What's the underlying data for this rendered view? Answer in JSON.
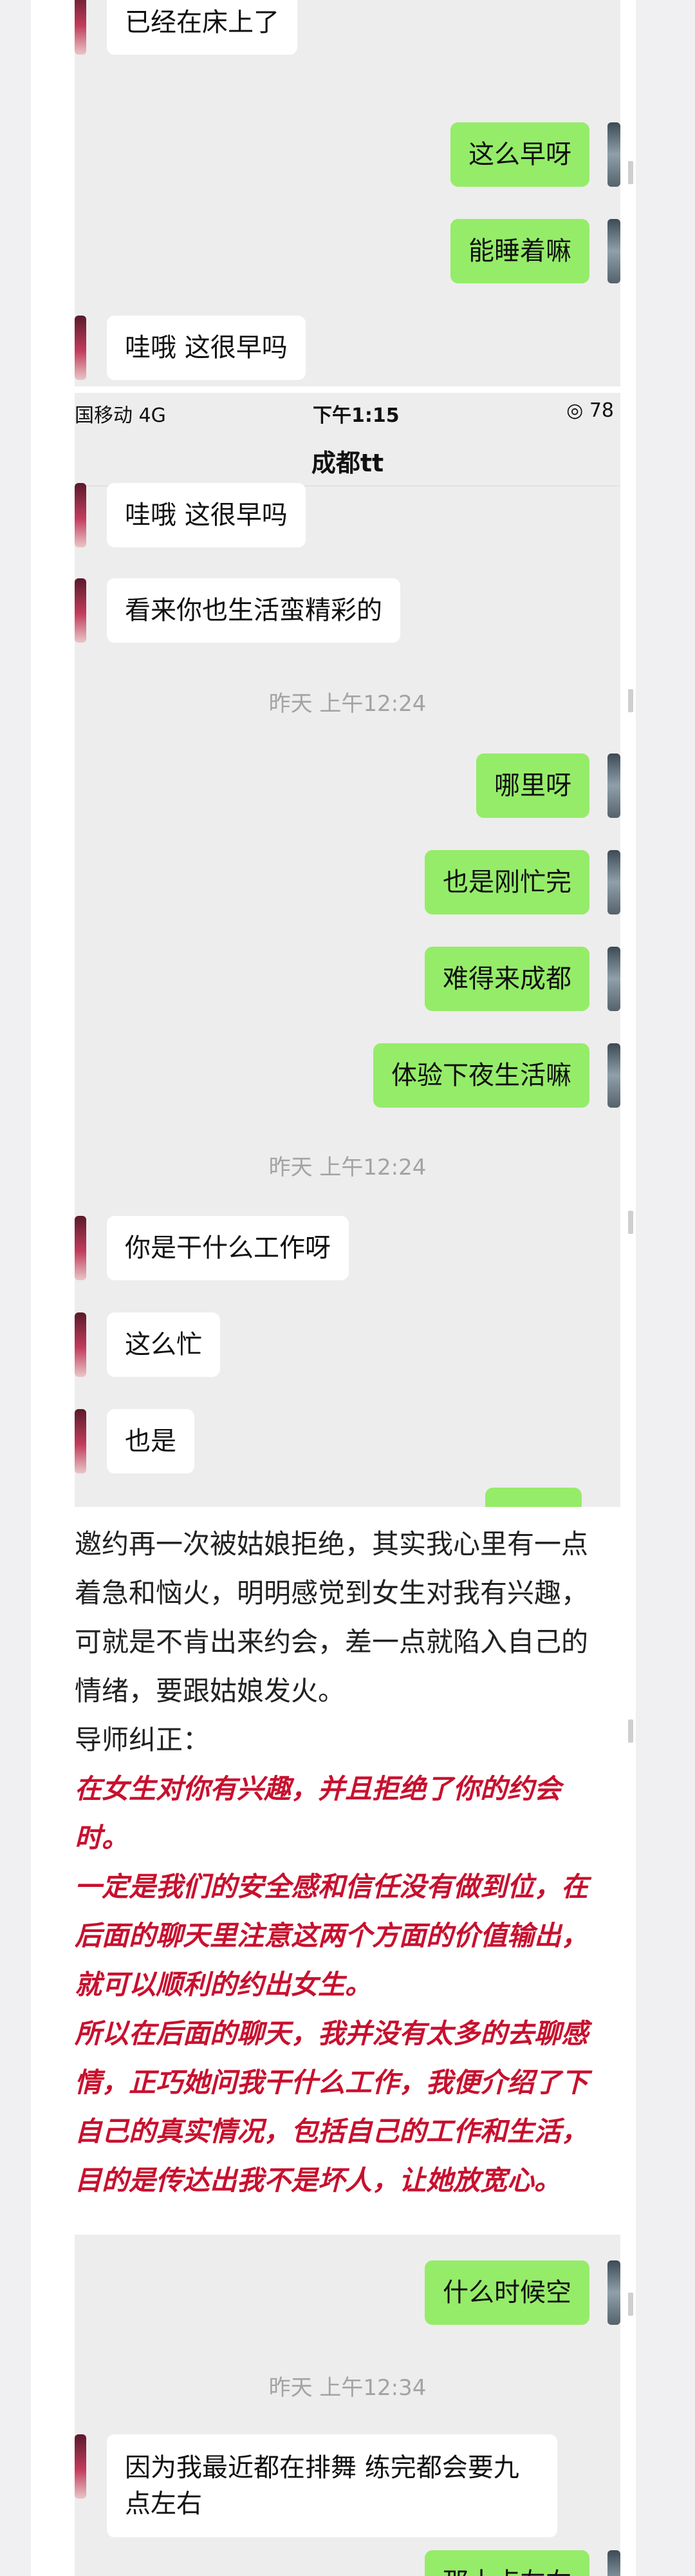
{
  "shot1": {
    "messages": [
      {
        "side": "left",
        "text": "已经在床上了"
      },
      {
        "side": "right",
        "text": "这么早呀"
      },
      {
        "side": "right",
        "text": "能睡着嘛"
      },
      {
        "side": "left",
        "text": "哇哦 这很早吗"
      }
    ]
  },
  "shot2": {
    "status": {
      "carrier": "国移动 4G",
      "time": "下午1:15",
      "battery": "◎ 78"
    },
    "chat_title": "成都tt",
    "messages_a": [
      {
        "side": "left",
        "text": "哇哦 这很早吗"
      },
      {
        "side": "left",
        "text": "看来你也生活蛮精彩的"
      }
    ],
    "stamp1": "昨天 上午12:24",
    "messages_b": [
      {
        "side": "right",
        "text": "哪里呀"
      },
      {
        "side": "right",
        "text": "也是刚忙完"
      },
      {
        "side": "right",
        "text": "难得来成都"
      },
      {
        "side": "right",
        "text": "体验下夜生活嘛"
      }
    ],
    "stamp2": "昨天 上午12:24",
    "messages_c": [
      {
        "side": "left",
        "text": "你是干什么工作呀"
      },
      {
        "side": "left",
        "text": "这么忙"
      },
      {
        "side": "left",
        "text": "也是"
      }
    ]
  },
  "article": {
    "para1": "邀约再一次被姑娘拒绝，其实我心里有一点着急和恼火，明明感觉到女生对我有兴趣，可就是不肯出来约会，差一点就陷入自己的情绪，要跟姑娘发火。",
    "para2": "导师纠正：",
    "emph1": "在女生对你有兴趣，并且拒绝了你的约会时。",
    "emph2": "一定是我们的安全感和信任没有做到位，在后面的聊天里注意这两个方面的价值输出，就可以顺利的约出女生。",
    "emph3": "所以在后面的聊天，我并没有太多的去聊感情，正巧她问我干什么工作，我便介绍了下自己的真实情况，包括自己的工作和生活，目的是传达出我不是坏人，让她放宽心。"
  },
  "shot3": {
    "msg1": {
      "side": "right",
      "text": "什么时候空"
    },
    "stamp": "昨天 上午12:34",
    "msg2": {
      "side": "left",
      "text": "因为我最近都在排舞 练完都会要九点左右"
    },
    "msg3_partial": {
      "side": "right",
      "text": "那十点左右"
    }
  },
  "colors": {
    "chat_bg": "#ededed",
    "outgoing_bubble": "#95ec69",
    "incoming_bubble": "#ffffff",
    "emphasis_text": "#c8102e",
    "timestamp_text": "#a3a3a3"
  }
}
